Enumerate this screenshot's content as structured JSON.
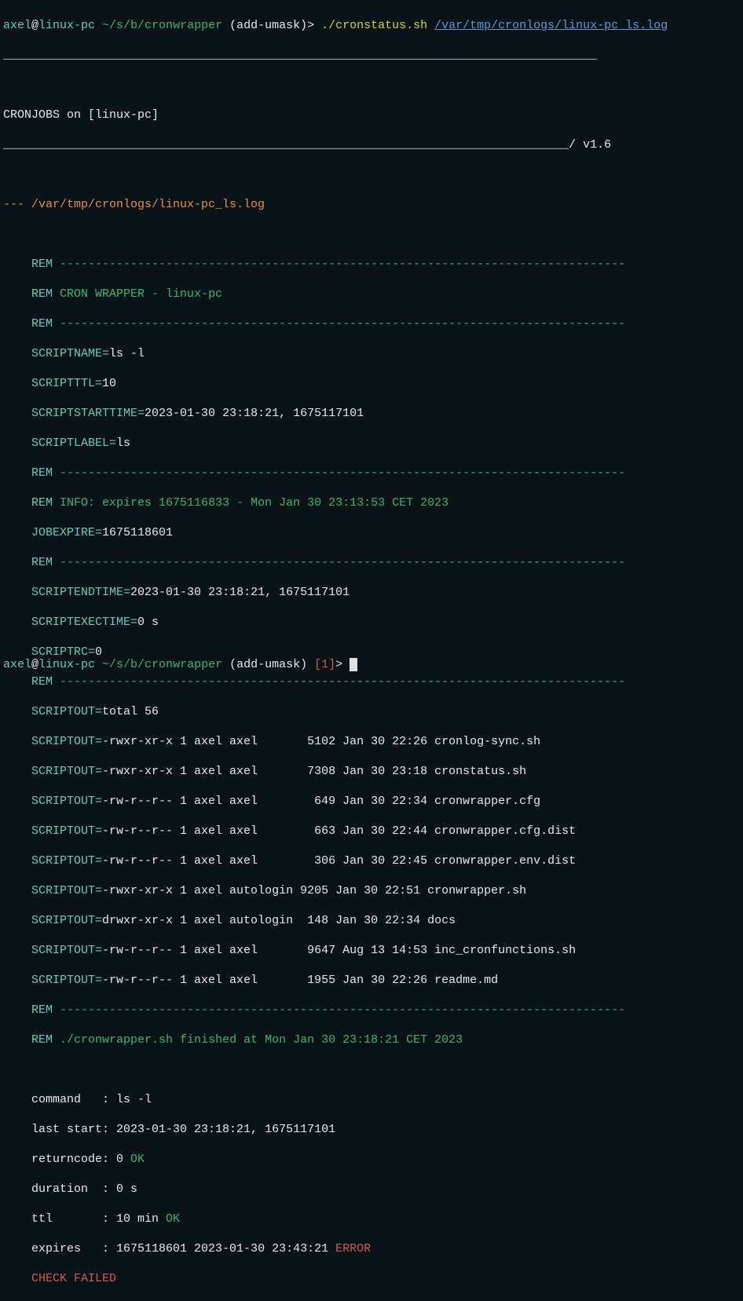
{
  "prompt1": {
    "user": "axel",
    "at": "@",
    "host": "linux-pc",
    "path": " ~/s/b/cronwrapper",
    "branch": " (add-umask)",
    "arrow": ">",
    "cmd": " ./cronstatus.sh ",
    "arg": "/var/tmp/cronlogs/linux-pc_ls.log"
  },
  "header": {
    "divider": "____________________________________________________________________________________",
    "cronjobs_label": "CRONJOBS on [",
    "cronjobs_host": "linux-pc",
    "cronjobs_close": "]",
    "bottom_line": "________________________________________________________________________________/ v1.6"
  },
  "logfile_line": "--- /var/tmp/cronlogs/linux-pc_ls.log",
  "rem_divider": " --------------------------------------------------------------------------------",
  "rem_label": "REM",
  "wrapper_title": " CRON WRAPPER - linux-pc",
  "vars": {
    "scriptname_k": "SCRIPTNAME=",
    "scriptname_v": "ls -l",
    "scriptttl_k": "SCRIPTTTL=",
    "scriptttl_v": "10",
    "scriptstarttime_k": "SCRIPTSTARTTIME=",
    "scriptstarttime_v": "2023-01-30 23:18:21, 1675117101",
    "scriptlabel_k": "SCRIPTLABEL=",
    "scriptlabel_v": "ls",
    "info_text": " INFO: expires 1675116833 - Mon Jan 30 23:13:53 CET 2023",
    "jobexpire_k": "JOBEXPIRE=",
    "jobexpire_v": "1675118601",
    "scriptendtime_k": "SCRIPTENDTIME=",
    "scriptendtime_v": "2023-01-30 23:18:21, 1675117101",
    "scriptexectime_k": "SCRIPTEXECTIME=",
    "scriptexectime_v": "0 s",
    "scriptrc_k": "SCRIPTRC=",
    "scriptrc_v": "0",
    "scriptout_k": "SCRIPTOUT="
  },
  "scriptout": {
    "total": "total 56",
    "lines": [
      "-rwxr-xr-x 1 axel axel       5102 Jan 30 22:26 cronlog-sync.sh",
      "-rwxr-xr-x 1 axel axel       7308 Jan 30 23:18 cronstatus.sh",
      "-rw-r--r-- 1 axel axel        649 Jan 30 22:34 cronwrapper.cfg",
      "-rw-r--r-- 1 axel axel        663 Jan 30 22:44 cronwrapper.cfg.dist",
      "-rw-r--r-- 1 axel axel        306 Jan 30 22:45 cronwrapper.env.dist",
      "-rwxr-xr-x 1 axel autologin 9205 Jan 30 22:51 cronwrapper.sh",
      "drwxr-xr-x 1 axel autologin  148 Jan 30 22:34 docs",
      "-rw-r--r-- 1 axel axel       9647 Aug 13 14:53 inc_cronfunctions.sh",
      "-rw-r--r-- 1 axel axel       1955 Jan 30 22:26 readme.md"
    ]
  },
  "finished": " ./cronwrapper.sh finished at Mon Jan 30 23:18:21 CET 2023",
  "summary": {
    "command": "command   : ls -l",
    "laststart": "last start: 2023-01-30 23:18:21, 1675117101",
    "returncode_pre": "returncode: 0 ",
    "returncode_ok": "OK",
    "duration": "duration  : 0 s",
    "ttl_pre": "ttl       : 10 min ",
    "ttl_ok": "OK",
    "expires_pre": "expires   : 1675118601 2023-01-30 23:43:21 ",
    "expires_err": "ERROR",
    "checkfailed": "CHECK FAILED"
  },
  "prompt2": {
    "user": "axel",
    "at": "@",
    "host": "linux-pc",
    "path": " ~/s/b/cronwrapper",
    "branch": " (add-umask)",
    "status": " [1]",
    "arrow": ">",
    "space": " "
  },
  "indent": "    "
}
